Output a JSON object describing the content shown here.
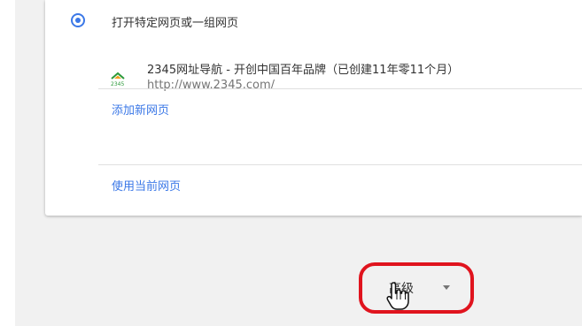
{
  "startup": {
    "radio_label": "打开特定网页或一组网页",
    "pages": [
      {
        "title": "2345网址导航 - 开创中国百年品牌（已创建11年零11个月）",
        "url": "http://www.2345.com/",
        "favicon": "2345-logo-icon"
      }
    ],
    "add_page_label": "添加新网页",
    "use_current_label": "使用当前网页"
  },
  "advanced": {
    "label": "高级"
  },
  "annotation": {
    "highlight_color": "#e0141e"
  },
  "colors": {
    "accent": "#3b78e7",
    "link": "#3b78e7",
    "text": "#333333",
    "secondary_text": "#757575",
    "background": "#f1f1f1",
    "card": "#ffffff"
  }
}
